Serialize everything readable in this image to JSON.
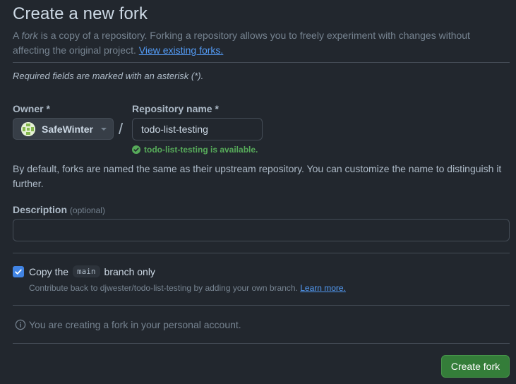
{
  "page": {
    "title": "Create a new fork",
    "subtitle_prefix": "A ",
    "subtitle_emphasis": "fork",
    "subtitle_rest": " is a copy of a repository. Forking a repository allows you to freely experiment with changes without affecting the original project. ",
    "subtitle_link": "View existing forks.",
    "required_note": "Required fields are marked with an asterisk (*)."
  },
  "owner": {
    "label": "Owner *",
    "name": "SafeWinter",
    "avatar_icon": "identicon-avatar",
    "dropdown_icon": "caret-down-icon"
  },
  "separator": "/",
  "repository": {
    "label": "Repository name *",
    "value": "todo-list-testing",
    "availability": "todo-list-testing is available.",
    "availability_color": "#57ab5a"
  },
  "naming_hint": "By default, forks are named the same as their upstream repository. You can customize the name to distinguish it further.",
  "description": {
    "label": "Description",
    "optional": "(optional)",
    "value": ""
  },
  "copy_branch": {
    "checked": true,
    "label_before": "Copy the",
    "branch": "main",
    "label_after": "branch only",
    "help_text": "Contribute back to djwester/todo-list-testing by adding your own branch.",
    "help_link": "Learn more."
  },
  "account_info": "You are creating a fork in your personal account.",
  "actions": {
    "create_label": "Create fork",
    "create_color": "#347d39"
  },
  "colors": {
    "background": "#22272e",
    "accent": "#539bf5",
    "checkbox": "#4184e4"
  }
}
